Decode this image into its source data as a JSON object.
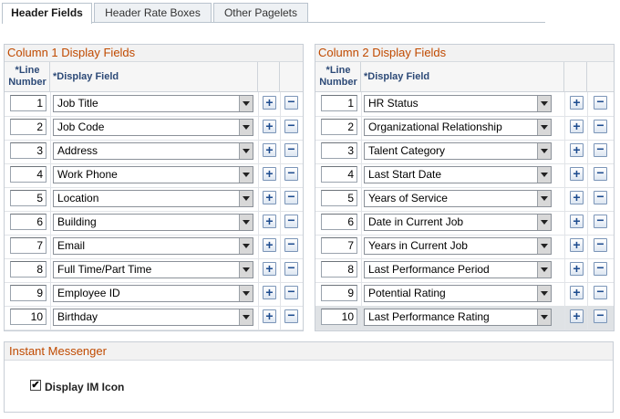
{
  "tabs": [
    "Header Fields",
    "Header Rate Boxes",
    "Other Pagelets"
  ],
  "column1": {
    "title": "Column 1 Display Fields",
    "header_line_required": "*Line",
    "header_line_number": "Number",
    "header_display_field": "*Display Field",
    "rows": [
      {
        "num": "1",
        "field": "Job Title"
      },
      {
        "num": "2",
        "field": "Job Code"
      },
      {
        "num": "3",
        "field": "Address"
      },
      {
        "num": "4",
        "field": "Work Phone"
      },
      {
        "num": "5",
        "field": "Location"
      },
      {
        "num": "6",
        "field": "Building"
      },
      {
        "num": "7",
        "field": "Email"
      },
      {
        "num": "8",
        "field": "Full Time/Part Time"
      },
      {
        "num": "9",
        "field": "Employee ID"
      },
      {
        "num": "10",
        "field": "Birthday"
      }
    ]
  },
  "column2": {
    "title": "Column 2 Display Fields",
    "header_line_required": "*Line",
    "header_line_number": "Number",
    "header_display_field": "*Display Field",
    "rows": [
      {
        "num": "1",
        "field": "HR Status"
      },
      {
        "num": "2",
        "field": "Organizational Relationship"
      },
      {
        "num": "3",
        "field": "Talent Category"
      },
      {
        "num": "4",
        "field": "Last Start Date"
      },
      {
        "num": "5",
        "field": "Years of Service"
      },
      {
        "num": "6",
        "field": "Date in Current Job"
      },
      {
        "num": "7",
        "field": "Years in Current Job"
      },
      {
        "num": "8",
        "field": "Last Performance Period"
      },
      {
        "num": "9",
        "field": "Potential Rating"
      },
      {
        "num": "10",
        "field": "Last Performance Rating"
      }
    ]
  },
  "buttons": {
    "add": "+",
    "remove": "−"
  },
  "instant_messenger": {
    "title": "Instant Messenger",
    "checkbox_label": "Display IM Icon",
    "checked": true,
    "check_mark": "✔"
  },
  "colors": {
    "section_title": "#c04a00",
    "header_text": "#2d4a77",
    "button_glyph": "#1e4c8f"
  }
}
